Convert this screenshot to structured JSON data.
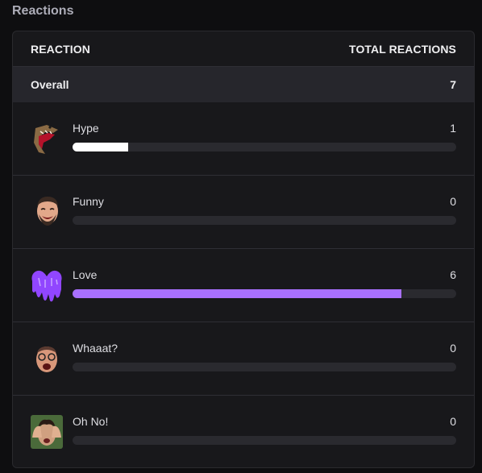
{
  "section_title": "Reactions",
  "table": {
    "col_reaction": "REACTION",
    "col_total": "TOTAL REACTIONS",
    "overall_label": "Overall",
    "overall_value": "7"
  },
  "reactions": [
    {
      "label": "Hype",
      "count": "1",
      "fraction": 0.145,
      "fill_color": "#ffffff",
      "icon": "dinosaur-emote-icon"
    },
    {
      "label": "Funny",
      "count": "0",
      "fraction": 0,
      "fill_color": "#ffffff",
      "icon": "laughing-man-emote-icon"
    },
    {
      "label": "Love",
      "count": "6",
      "fraction": 0.858,
      "fill_color": "#a970ff",
      "icon": "purple-dripping-heart-icon"
    },
    {
      "label": "Whaaat?",
      "count": "0",
      "fraction": 0,
      "fill_color": "#ffffff",
      "icon": "shocked-man-emote-icon"
    },
    {
      "label": "Oh No!",
      "count": "0",
      "fraction": 0,
      "fill_color": "#ffffff",
      "icon": "facepalm-emote-icon"
    }
  ]
}
